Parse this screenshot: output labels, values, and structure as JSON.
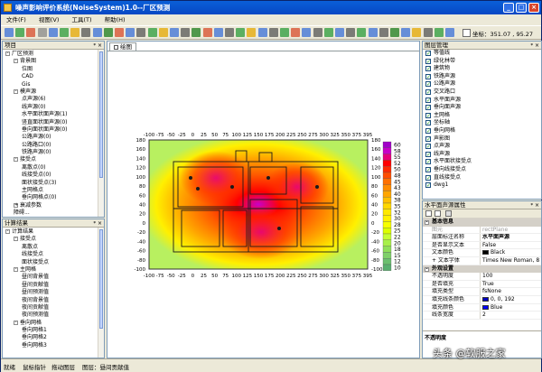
{
  "window": {
    "title": "噪声影响评价系统(NoiseSystem)1.0--厂区预测"
  },
  "menu": [
    "文件(F)",
    "视图(V)",
    "工具(T)",
    "帮助(H)"
  ],
  "toolbar": {
    "coord_label": "坐标：",
    "coord_value": "351.07 , 95.27"
  },
  "project_panel": {
    "title": "项目",
    "tree": [
      {
        "level": 0,
        "exp": "-",
        "label": "厂区预测"
      },
      {
        "level": 1,
        "exp": "-",
        "label": "背景图"
      },
      {
        "level": 2,
        "exp": "",
        "label": "位图"
      },
      {
        "level": 2,
        "exp": "",
        "label": "CAD"
      },
      {
        "level": 2,
        "exp": "",
        "label": "Gis"
      },
      {
        "level": 1,
        "exp": "-",
        "label": "模声源"
      },
      {
        "level": 2,
        "exp": "",
        "label": "点声源(6)"
      },
      {
        "level": 2,
        "exp": "",
        "label": "线声源(0)"
      },
      {
        "level": 2,
        "exp": "",
        "label": "水平面状面声源(1)"
      },
      {
        "level": 2,
        "exp": "",
        "label": "竖直面状面声源(0)"
      },
      {
        "level": 2,
        "exp": "",
        "label": "垂向面状面声源(0)"
      },
      {
        "level": 2,
        "exp": "",
        "label": "公路声源(0)"
      },
      {
        "level": 2,
        "exp": "",
        "label": "公路路口(0)"
      },
      {
        "level": 2,
        "exp": "",
        "label": "铁路声源(0)"
      },
      {
        "level": 1,
        "exp": "-",
        "label": "接受点"
      },
      {
        "level": 2,
        "exp": "",
        "label": "离散点(0)"
      },
      {
        "level": 2,
        "exp": "",
        "label": "线接受点(0)"
      },
      {
        "level": 2,
        "exp": "",
        "label": "面状接受点(3)"
      },
      {
        "level": 2,
        "exp": "",
        "label": "主网格点"
      },
      {
        "level": 2,
        "exp": "",
        "label": "垂向网格点(0)"
      },
      {
        "level": 1,
        "exp": "+",
        "label": "衰减参数"
      },
      {
        "level": 1,
        "exp": "",
        "label": "障碍..."
      }
    ]
  },
  "result_panel": {
    "title": "计算结果",
    "tree": [
      {
        "level": 0,
        "exp": "-",
        "label": "计算结果"
      },
      {
        "level": 1,
        "exp": "-",
        "label": "接受点"
      },
      {
        "level": 2,
        "exp": "",
        "label": "离散点"
      },
      {
        "level": 2,
        "exp": "",
        "label": "线接受点"
      },
      {
        "level": 2,
        "exp": "",
        "label": "面状接受点"
      },
      {
        "level": 1,
        "exp": "-",
        "label": "主网格"
      },
      {
        "level": 2,
        "exp": "",
        "label": "昼间背景值"
      },
      {
        "level": 2,
        "exp": "",
        "label": "昼间贡献值"
      },
      {
        "level": 2,
        "exp": "",
        "label": "昼间预测值"
      },
      {
        "level": 2,
        "exp": "",
        "label": "夜间背景值"
      },
      {
        "level": 2,
        "exp": "",
        "label": "夜间贡献值"
      },
      {
        "level": 2,
        "exp": "",
        "label": "夜间预测值"
      },
      {
        "level": 1,
        "exp": "-",
        "label": "垂向网格"
      },
      {
        "level": 2,
        "exp": "",
        "label": "垂向网格1"
      },
      {
        "level": 2,
        "exp": "",
        "label": "垂向网格2"
      },
      {
        "level": 2,
        "exp": "",
        "label": "垂向网格3"
      }
    ]
  },
  "drawing": {
    "tab_label": "绘图",
    "x_ticks": [
      "-100",
      "-75",
      "-50",
      "-25",
      "0",
      "25",
      "50",
      "75",
      "100",
      "125",
      "150",
      "175",
      "200",
      "225",
      "250",
      "275",
      "300",
      "325",
      "350",
      "375",
      "395"
    ],
    "y_ticks": [
      "180",
      "160",
      "140",
      "120",
      "100",
      "80",
      "60",
      "40",
      "20",
      "0",
      "-20",
      "-40",
      "-60",
      "-80",
      "-100"
    ],
    "legend_values": [
      "60",
      "58",
      "55",
      "52",
      "50",
      "48",
      "45",
      "43",
      "40",
      "38",
      "35",
      "32",
      "30",
      "28",
      "25",
      "22",
      "20",
      "18",
      "15",
      "12",
      "10"
    ],
    "legend_colors": [
      "#a000c8",
      "#c800c8",
      "#e6007a",
      "#ff0000",
      "#ff2a00",
      "#ff4d00",
      "#ff7000",
      "#ff8c00",
      "#ffa500",
      "#ffbf00",
      "#ffd700",
      "#ffe900",
      "#fff200",
      "#f6ff00",
      "#ddff00",
      "#c6ff33",
      "#a8f04a",
      "#8fe05a",
      "#7fd06a",
      "#6cc070",
      "#5ab070"
    ]
  },
  "layers_panel": {
    "title": "图层管理",
    "items": [
      "等值线",
      "绿化林带",
      "建筑物",
      "铁路声源",
      "公路声源",
      "交叉路口",
      "水平面声源",
      "垂向面声源",
      "主网格",
      "坐标轴",
      "垂向网格",
      "声影图",
      "点声源",
      "线声源",
      "水平面状接受点",
      "垂向线接受点",
      "直线接受点",
      "dwg1"
    ]
  },
  "props_panel": {
    "title": "水平面声源属性",
    "rows": [
      {
        "type": "cat",
        "label": "基本信息"
      },
      {
        "type": "row",
        "name": "图元",
        "value": "rectPlane",
        "dim": true
      },
      {
        "type": "row",
        "name": "层面标注名称",
        "value": "水平面声源",
        "bold": true
      },
      {
        "type": "row",
        "name": "是否显示文本",
        "value": "False"
      },
      {
        "type": "row",
        "name": "文本颜色",
        "value": "Black",
        "swatch": "#000000"
      },
      {
        "type": "row",
        "name": "文本字体",
        "value": "Times New Roman, 8",
        "plus": true
      },
      {
        "type": "cat",
        "label": "外观设置"
      },
      {
        "type": "row",
        "name": "不透明度",
        "value": "100"
      },
      {
        "type": "row",
        "name": "是否填充",
        "value": "True"
      },
      {
        "type": "row",
        "name": "填充类型",
        "value": "fsNone"
      },
      {
        "type": "row",
        "name": "填充线条颜色",
        "value": "0, 0, 192",
        "swatch": "#0000c0"
      },
      {
        "type": "row",
        "name": "填充颜色",
        "value": "Blue",
        "swatch": "#0000ff"
      },
      {
        "type": "row",
        "name": "线条宽度",
        "value": "2"
      }
    ],
    "desc_label": "不透明度"
  },
  "status": [
    "就绪",
    "鼠标指针",
    "拖动图层",
    "图层：昼间贡献值"
  ],
  "watermark": "头条 @软服之家"
}
